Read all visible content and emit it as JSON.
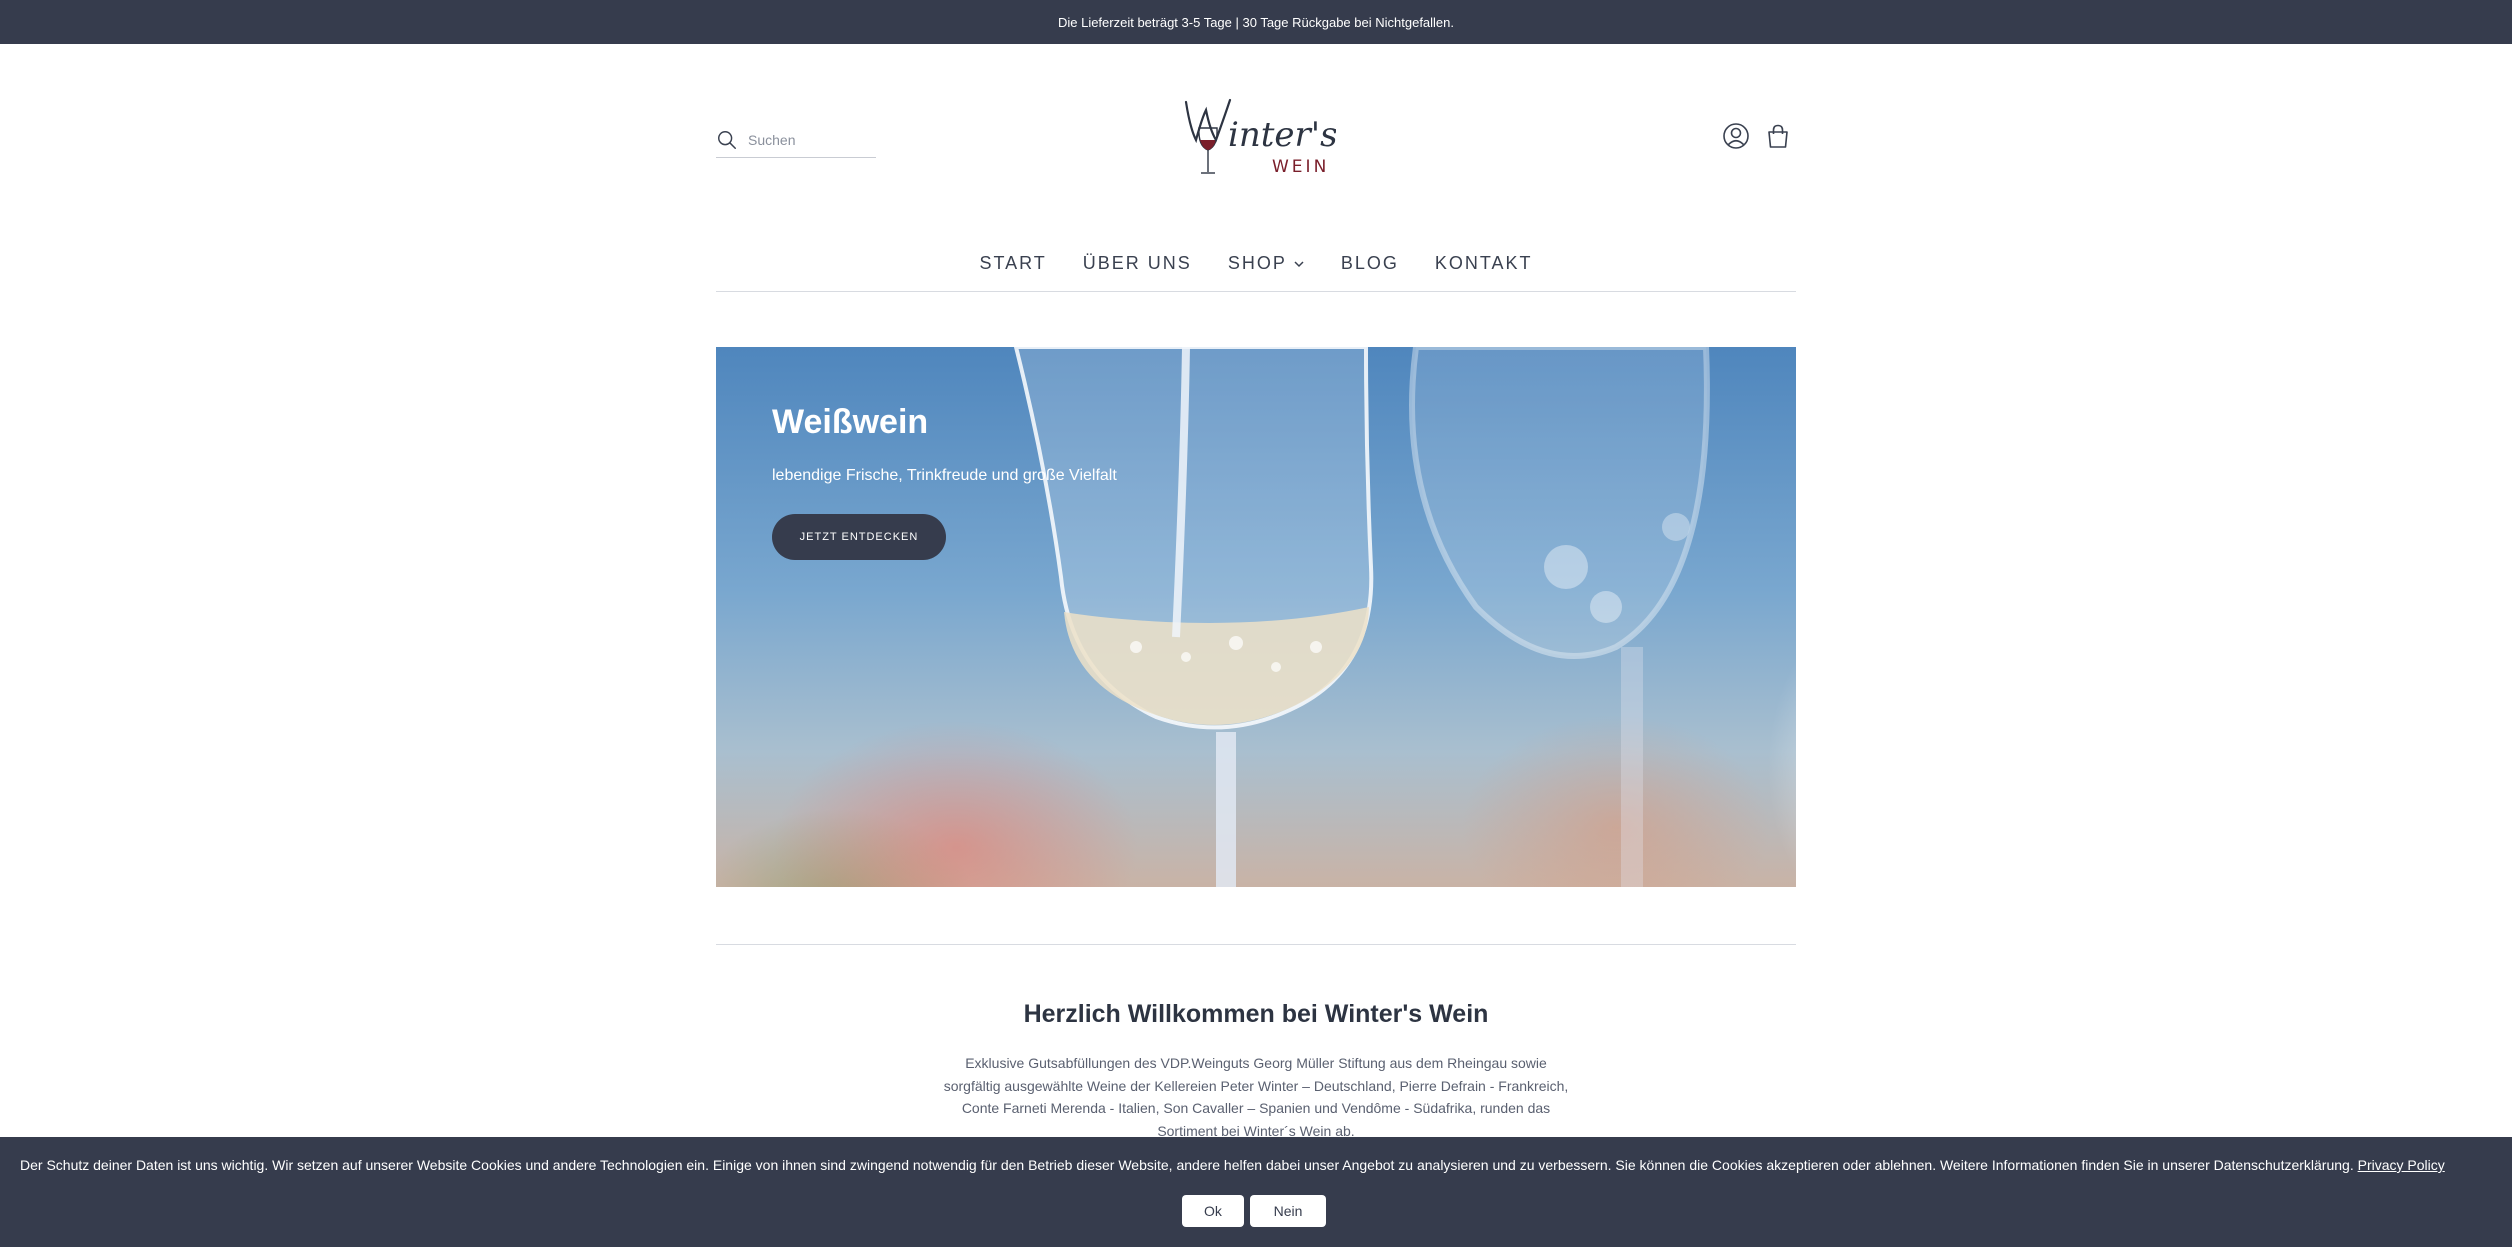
{
  "announcement": "Die Lieferzeit beträgt 3-5 Tage | 30 Tage Rückgabe bei Nichtgefallen.",
  "search": {
    "placeholder": "Suchen"
  },
  "logo": {
    "script_text": "Winter's",
    "word": "WEIN",
    "wine_color": "#7a1f2b"
  },
  "header_icons": [
    "account-icon",
    "cart-icon"
  ],
  "nav": {
    "items": [
      {
        "label": "START"
      },
      {
        "label": "ÜBER UNS"
      },
      {
        "label": "SHOP",
        "has_dropdown": true
      },
      {
        "label": "BLOG"
      },
      {
        "label": "KONTAKT"
      }
    ]
  },
  "hero": {
    "title": "Weißwein",
    "subtitle": "lebendige Frische, Trinkfreude und große Vielfalt",
    "button": "JETZT ENTDECKEN"
  },
  "welcome": {
    "title": "Herzlich Willkommen bei Winter's Wein",
    "text": "Exklusive Gutsabfüllungen des VDP.Weinguts Georg Müller Stiftung aus dem Rheingau sowie sorgfältig ausgewählte Weine der Kellereien Peter Winter – Deutschland, Pierre Defrain - Frankreich, Conte Farneti Merenda - Italien, Son Cavaller – Spanien und Vendôme - Südafrika, runden das Sortiment bei Winter´s Wein ab."
  },
  "cookie": {
    "text": "Der Schutz deiner Daten ist uns wichtig. Wir setzen auf unserer Website Cookies und andere Technologien ein. Einige von ihnen sind zwingend notwendig für den Betrieb dieser Website, andere helfen dabei unser Angebot zu analysieren und zu verbessern. Sie können die Cookies akzeptieren oder ablehnen. Weitere Informationen finden Sie in unserer Datenschutzerklärung.",
    "link": "Privacy Policy",
    "ok": "Ok",
    "no": "Nein"
  },
  "colors": {
    "dark": "#363c4d",
    "text": "#3a4150",
    "wine": "#7a1f2b",
    "white": "#ffffff"
  }
}
